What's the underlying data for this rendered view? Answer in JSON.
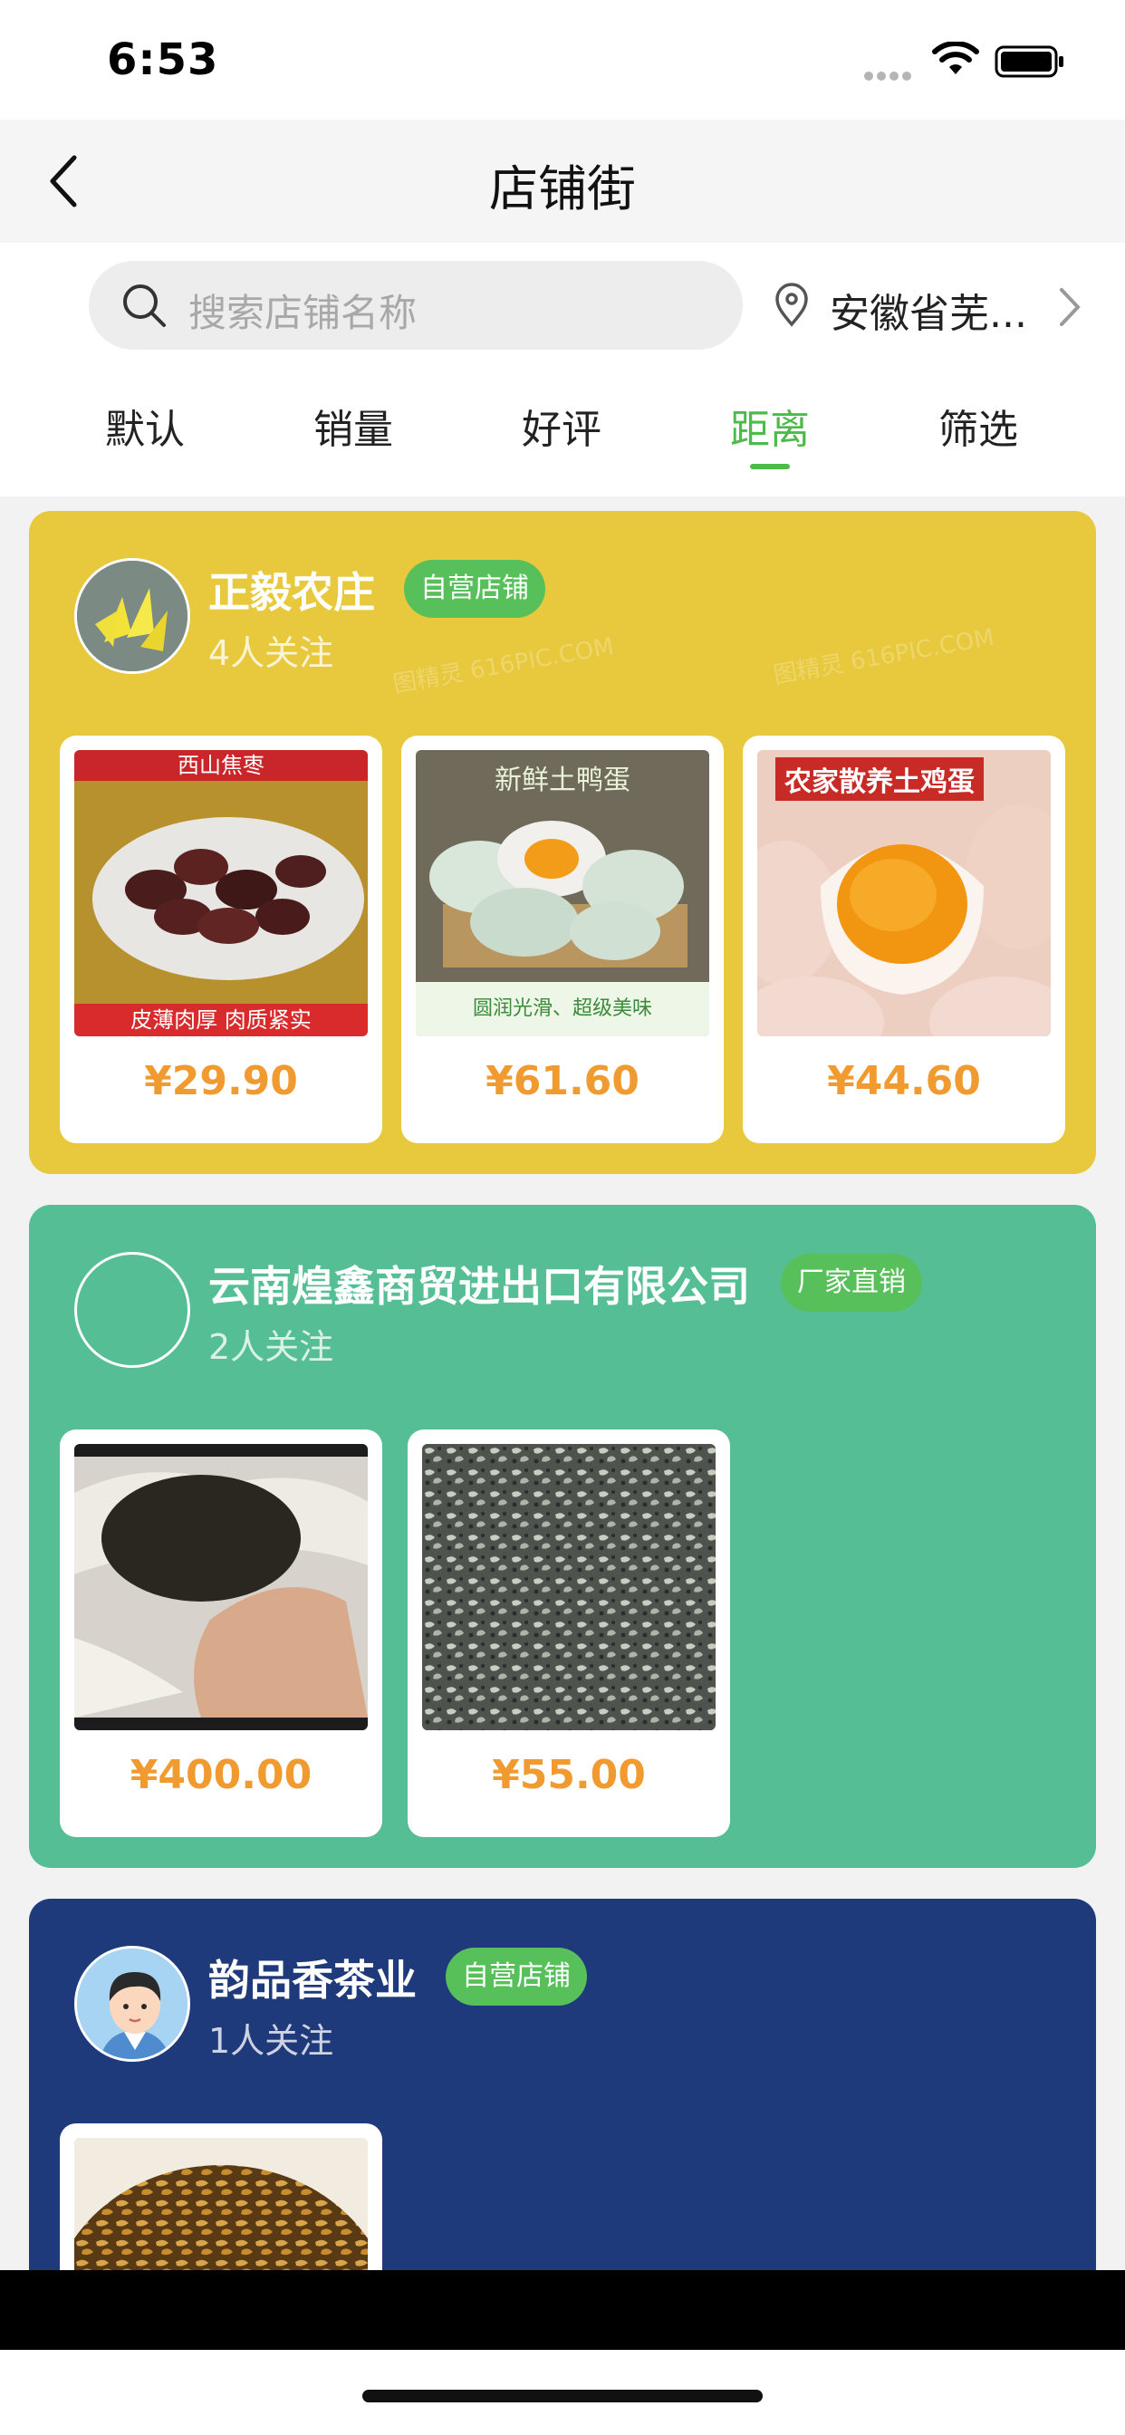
{
  "status_bar": {
    "time": "6:53"
  },
  "nav": {
    "title": "店铺街"
  },
  "search": {
    "placeholder": "搜索店铺名称"
  },
  "location": {
    "text": "安徽省芜..."
  },
  "sort_tabs": [
    {
      "label": "默认",
      "active": false
    },
    {
      "label": "销量",
      "active": false
    },
    {
      "label": "好评",
      "active": false
    },
    {
      "label": "距离",
      "active": true
    },
    {
      "label": "筛选",
      "active": false
    }
  ],
  "colors": {
    "accent": "#4cbb47",
    "price": "#f09a2f",
    "shop1_bg": "#e8c83c",
    "shop2_bg": "#55be94",
    "shop3_bg": "#1f3a7a",
    "badge": "#58c05a"
  },
  "shops": [
    {
      "name": "正毅农庄",
      "badge": "自营店铺",
      "followers": "4人关注",
      "watermark": "图精灵 616PIC.COM",
      "products": [
        {
          "price": "¥29.90",
          "image": "dried-dates",
          "banner_top": "西山焦枣",
          "banner_bottom": "皮薄肉厚 肉质紧实"
        },
        {
          "price": "¥61.60",
          "image": "salted-duck-eggs",
          "banner_top": "新鲜土鸭蛋",
          "banner_bottom": "圆润光滑、超级美味"
        },
        {
          "price": "¥44.60",
          "image": "farm-eggs",
          "banner_top": "农家散养土鸡蛋"
        }
      ]
    },
    {
      "name": "云南煌鑫商贸进出口有限公司",
      "badge": "厂家直销",
      "followers": "2人关注",
      "products": [
        {
          "price": "¥400.00",
          "image": "pu-erh-tea-cake"
        },
        {
          "price": "¥55.00",
          "image": "green-tea-leaves"
        }
      ]
    },
    {
      "name": "韵品香茶业",
      "badge": "自营店铺",
      "followers": "1人关注",
      "products": [
        {
          "image": "golden-tea-buds"
        }
      ]
    }
  ]
}
